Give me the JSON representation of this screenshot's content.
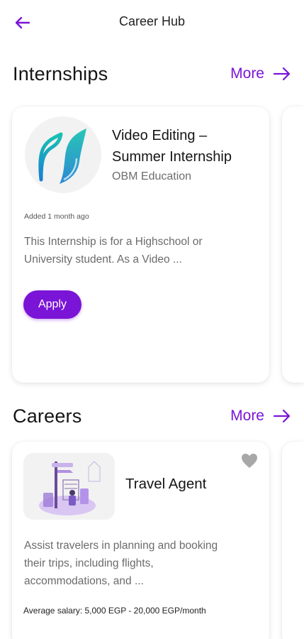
{
  "header": {
    "back_icon": "arrow-left-icon",
    "title": "Career Hub"
  },
  "internships": {
    "section_title": "Internships",
    "more_label": "More",
    "more_icon": "arrow-right-icon",
    "cards": [
      {
        "logo_icon": "obm-education-logo-icon",
        "title": "Video Editing – Summer Internship",
        "company": "OBM Education",
        "added": "Added 1 month ago",
        "description": "This Internship is for a Highschool or University student. As a Video ...",
        "apply_label": "Apply"
      }
    ]
  },
  "careers": {
    "section_title": "Careers",
    "more_label": "More",
    "more_icon": "arrow-right-icon",
    "cards": [
      {
        "image_icon": "travel-illustration-icon",
        "title": "Travel Agent",
        "favorite_icon": "heart-icon",
        "description": "Assist travelers in planning and booking their trips, including flights, accommodations, and ...",
        "salary": "Average salary: 5,000 EGP - 20,000 EGP/month"
      }
    ]
  },
  "colors": {
    "accent": "#7a14d6",
    "heart": "#a8a8a8",
    "card_bg": "#ffffff",
    "logo_bg": "#f2f2f2"
  }
}
